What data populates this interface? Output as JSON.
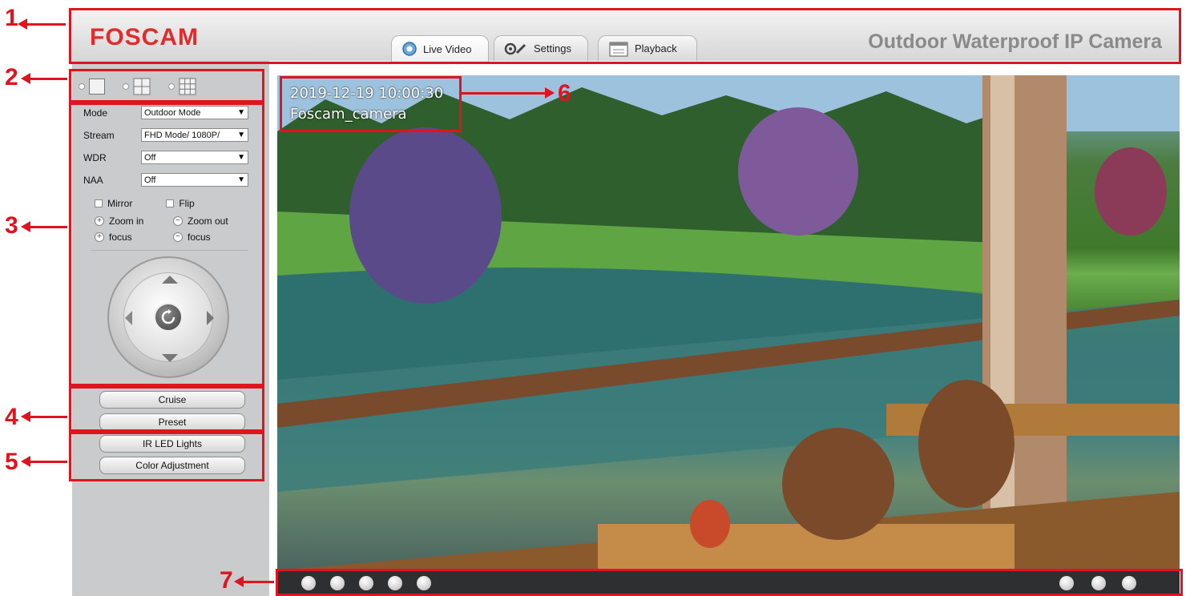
{
  "header": {
    "logo": "FOSCAM",
    "product_name": "Outdoor Waterproof IP Camera",
    "tabs": [
      {
        "label": "Live Video",
        "icon": "live-video-icon",
        "active": true
      },
      {
        "label": "Settings",
        "icon": "settings-icon",
        "active": false
      },
      {
        "label": "Playback",
        "icon": "calendar-icon",
        "active": false
      }
    ]
  },
  "sidebar": {
    "view_modes": [
      "1-screen",
      "4-screen",
      "9-screen"
    ],
    "controls": [
      {
        "label": "Mode",
        "value": "Outdoor Mode"
      },
      {
        "label": "Stream",
        "value": "FHD Mode/ 1080P/"
      },
      {
        "label": "WDR",
        "value": "Off"
      },
      {
        "label": "NAA",
        "value": "Off"
      }
    ],
    "mirror_label": "Mirror",
    "flip_label": "Flip",
    "zoom_in_label": "Zoom in",
    "zoom_out_label": "Zoom out",
    "focus_in_label": "focus",
    "focus_out_label": "focus",
    "cruise_label": "Cruise",
    "preset_label": "Preset",
    "ir_label": "IR LED Lights",
    "color_label": "Color Adjustment"
  },
  "video": {
    "timestamp": "2019-12-19  10:00:30",
    "camera_name": "Foscam_camera"
  },
  "annotations": {
    "labels": [
      "1",
      "2",
      "3",
      "4",
      "5",
      "6",
      "7"
    ],
    "color": "#e0141e"
  },
  "colors": {
    "brand": "#e22b2b",
    "sidebar": "#c9cbcd",
    "toolbar": "#2e2f31"
  }
}
